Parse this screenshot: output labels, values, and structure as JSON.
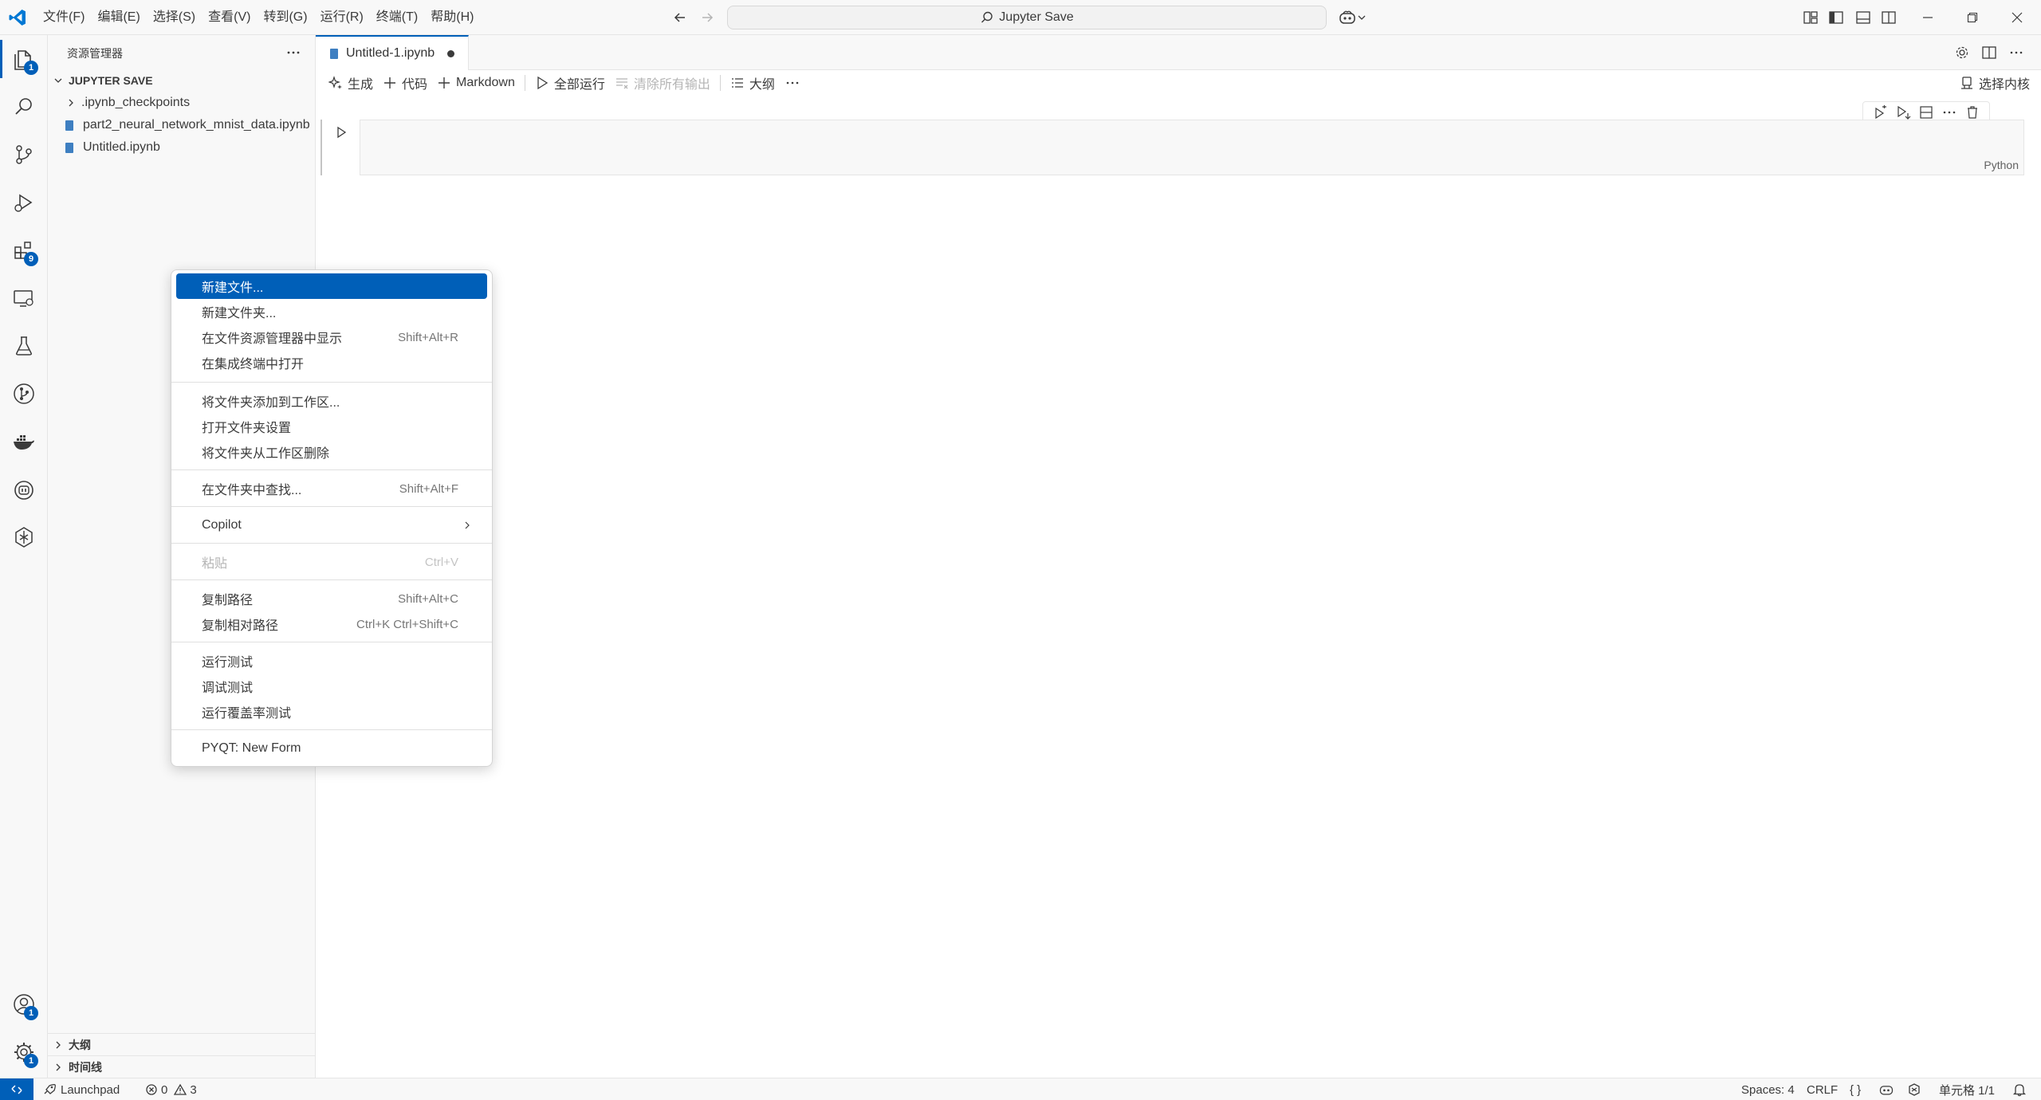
{
  "window": {
    "menus": [
      "文件(F)",
      "编辑(E)",
      "选择(S)",
      "查看(V)",
      "转到(G)",
      "运行(R)",
      "终端(T)",
      "帮助(H)"
    ],
    "search_label": "Jupyter Save"
  },
  "activity_bar": {
    "explorer_badge": "1",
    "extensions_badge": "9",
    "accounts_badge": "1",
    "settings_badge": "1"
  },
  "sidebar": {
    "title": "资源管理器",
    "folder_name": "JUPYTER SAVE",
    "items": [
      {
        "label": ".ipynb_checkpoints",
        "type": "folder"
      },
      {
        "label": "part2_neural_network_mnist_data.ipynb",
        "type": "notebook"
      },
      {
        "label": "Untitled.ipynb",
        "type": "notebook"
      }
    ],
    "sections": [
      "大纲",
      "时间线"
    ]
  },
  "editor": {
    "tab_label": "Untitled-1.ipynb",
    "toolbar": {
      "generate": "生成",
      "code": "代码",
      "markdown": "Markdown",
      "run_all": "全部运行",
      "clear_outputs": "清除所有输出",
      "outline": "大纲",
      "select_kernel": "选择内核"
    },
    "cell_language": "Python"
  },
  "context_menu": {
    "groups": [
      [
        {
          "label": "新建文件...",
          "shortcut": "",
          "selected": true
        },
        {
          "label": "新建文件夹...",
          "shortcut": ""
        },
        {
          "label": "在文件资源管理器中显示",
          "shortcut": "Shift+Alt+R"
        },
        {
          "label": "在集成终端中打开",
          "shortcut": ""
        }
      ],
      [
        {
          "label": "将文件夹添加到工作区...",
          "shortcut": ""
        },
        {
          "label": "打开文件夹设置",
          "shortcut": ""
        },
        {
          "label": "将文件夹从工作区删除",
          "shortcut": ""
        }
      ],
      [
        {
          "label": "在文件夹中查找...",
          "shortcut": "Shift+Alt+F"
        }
      ],
      [
        {
          "label": "Copilot",
          "shortcut": "",
          "submenu": true
        }
      ],
      [
        {
          "label": "粘贴",
          "shortcut": "Ctrl+V",
          "disabled": true
        }
      ],
      [
        {
          "label": "复制路径",
          "shortcut": "Shift+Alt+C"
        },
        {
          "label": "复制相对路径",
          "shortcut": "Ctrl+K Ctrl+Shift+C"
        }
      ],
      [
        {
          "label": "运行测试",
          "shortcut": ""
        },
        {
          "label": "调试测试",
          "shortcut": ""
        },
        {
          "label": "运行覆盖率测试",
          "shortcut": ""
        }
      ],
      [
        {
          "label": "PYQT: New Form",
          "shortcut": ""
        }
      ]
    ]
  },
  "status_bar": {
    "launchpad": "Launchpad",
    "errors": "0",
    "warnings": "3",
    "spaces": "Spaces: 4",
    "eol": "CRLF",
    "braces": "{ }",
    "cell_position": "单元格 1/1"
  },
  "colors": {
    "accent": "#005fb8",
    "sidebar_bg": "#f8f8f8",
    "notebook_icon": "#3e7fc1"
  }
}
